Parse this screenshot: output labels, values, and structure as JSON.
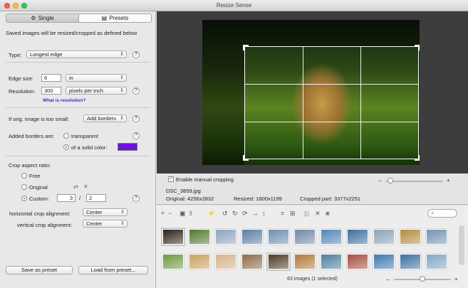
{
  "window": {
    "title": "Resize Sense"
  },
  "tabs": [
    {
      "label": "Single",
      "icon": "gear-icon",
      "active": true
    },
    {
      "label": "Presets",
      "icon": "list-icon",
      "active": false
    }
  ],
  "left": {
    "intro": "Saved images will be resized/cropped as defined below",
    "type_label": "Type:",
    "type_value": "Longest edge",
    "edge_label": "Edge size:",
    "edge_value": "6",
    "edge_unit": "in",
    "res_label": "Resolution:",
    "res_value": "300",
    "res_unit": "pixels per inch",
    "res_link": "What is resolution?",
    "small_label": "If orig. image is too small:",
    "small_value": "Add borders",
    "borders_label": "Added borders are:",
    "borders_transparent": "transparent",
    "borders_solid": "of a solid color:",
    "border_color": "#6b16d8",
    "aspect_label": "Crop aspect ratio:",
    "aspect_free": "Free",
    "aspect_original": "Original",
    "aspect_custom": "Custom:",
    "aspect_w": "3",
    "aspect_sep": "/",
    "aspect_h": "2",
    "h_align_label": "horizontal crop alignment:",
    "h_align_value": "Center",
    "v_align_label": "vertical crop alignment:",
    "v_align_value": "Center",
    "save_preset": "Save as preset",
    "load_preset": "Load from preset...",
    "help": "?"
  },
  "info": {
    "manual_crop_label": "Enable manual cropping",
    "manual_crop_checked": true,
    "filename": "DSC_3859.jpg",
    "original": "Original: 4256x2832",
    "resized": "Resized: 1800x1199",
    "cropped": "Cropped part: 3377x2251",
    "zoom_minus": "–",
    "zoom_plus": "+",
    "zoom_level": 0.08
  },
  "browser": {
    "status": "63 images (1 selected)",
    "size_level": 0.5,
    "thumbs_row1": [
      "#2b2016",
      "#4f7a2c",
      "#8aa6c0",
      "#5b7fa8",
      "#6c8fb5",
      "#6e8aa6",
      "#4f86b8",
      "#3b6f9b",
      "#8ca4b8",
      "#b58d3d",
      "#7394b3"
    ],
    "thumbs_row2": [
      "#6b9a3c",
      "#c9a25e",
      "#d7b48a",
      "#8b6a45",
      "#4b3a22",
      "#b07a3a",
      "#4d7e9c",
      "#a54b3d",
      "#3c78b0",
      "#3d6f9e",
      "#84a6c6"
    ]
  },
  "colors": {
    "accent": "#2a63d8",
    "link": "#3b2dd0"
  }
}
